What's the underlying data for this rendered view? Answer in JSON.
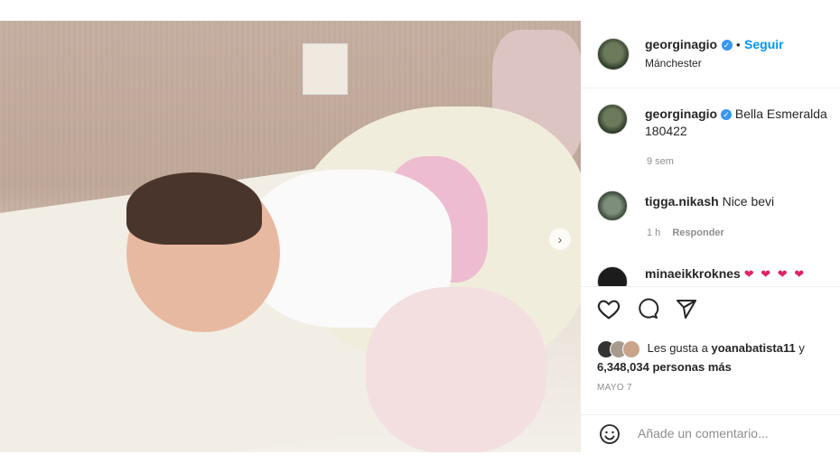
{
  "header": {
    "username": "georginagio",
    "separator": "•",
    "follow_label": "Seguir",
    "location": "Mánchester",
    "verified_icon": "verified-badge-icon"
  },
  "caption": {
    "username": "georginagio",
    "text": "Bella Esmeralda 180422",
    "time": "9 sem"
  },
  "comments": [
    {
      "username": "tigga.nikash",
      "text": "Nice bevi",
      "time": "1 h",
      "reply_label": "Responder"
    },
    {
      "username": "minaeikkroknes",
      "hearts": "❤ ❤ ❤ ❤"
    }
  ],
  "actions": {
    "like_icon": "heart-icon",
    "comment_icon": "comment-icon",
    "share_icon": "send-icon"
  },
  "likes": {
    "prefix": "Les gusta a",
    "user": "yoanabatista11",
    "joiner": "y",
    "count": "6,348,034 personas más"
  },
  "date": "MAYO 7",
  "add_comment": {
    "placeholder": "Añade un comentario...",
    "emoji_icon": "emoji-icon"
  },
  "photo": {
    "next_icon": "chevron-right-icon"
  },
  "colors": {
    "link": "#0095f6",
    "verified": "#3897f0",
    "heart": "#e0245e",
    "muted": "#8e8e8e"
  }
}
